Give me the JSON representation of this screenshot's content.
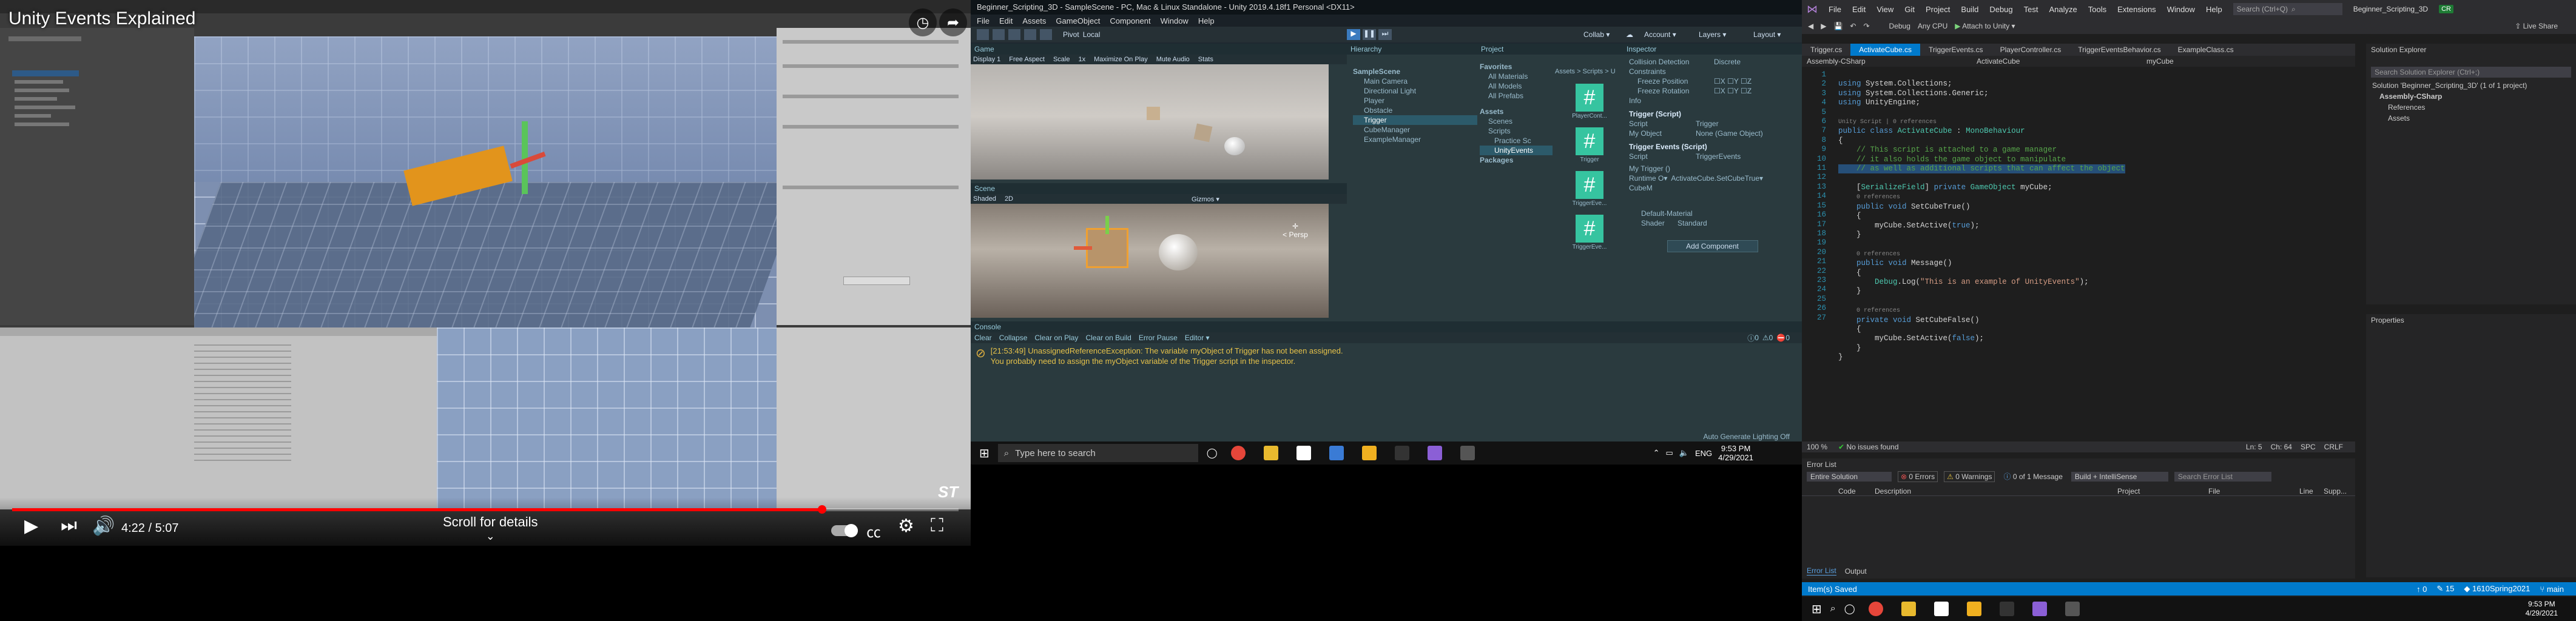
{
  "youtube": {
    "title": "Unity Events Explained",
    "time": "4:22 / 5:07",
    "progress": 0.855,
    "scroll_hint": "Scroll for details",
    "brand": "ST"
  },
  "unity": {
    "window_title": "Beginner_Scripting_3D - SampleScene - PC, Mac & Linux Standalone - Unity 2019.4.18f1 Personal <DX11>",
    "menu": [
      "File",
      "Edit",
      "Assets",
      "GameObject",
      "Component",
      "Window",
      "Help"
    ],
    "toolbar": {
      "pivot": "Pivot",
      "local": "Local",
      "collab": "Collab ▾",
      "account": "Account ▾",
      "layers": "Layers ▾",
      "layout": "Layout ▾"
    },
    "game": {
      "tab": "Game",
      "display": "Display 1",
      "aspect": "Free Aspect",
      "scale_label": "Scale",
      "scale": "1x",
      "maximize": "Maximize On Play",
      "mute": "Mute Audio",
      "stats": "Stats"
    },
    "scene": {
      "tab": "Scene",
      "shading": "Shaded",
      "mode": "2D",
      "gizmos": "Gizmos ▾",
      "persp": "< Persp"
    },
    "hierarchy": {
      "tab": "Hierarchy",
      "items": [
        "SampleScene",
        "Main Camera",
        "Directional Light",
        "Player",
        "Obstacle",
        "Trigger",
        "CubeManager",
        "ExampleManager"
      ]
    },
    "project": {
      "tab": "Project",
      "favorites": "Favorites",
      "fav_items": [
        "All Materials",
        "All Models",
        "All Prefabs"
      ],
      "assets": "Assets",
      "asset_items": [
        "Scenes",
        "Scripts",
        "Practice Sc",
        "UnityEvents"
      ],
      "packages": "Packages",
      "breadcrumb": "Assets > Scripts > U",
      "files": [
        "PlayerCont...",
        "Trigger",
        "TriggerEve...",
        "TriggerEve..."
      ]
    },
    "inspector": {
      "tab": "Inspector",
      "collision_label": "Collision Detection",
      "collision_value": "Discrete",
      "constraints": "Constraints",
      "freeze_pos": "Freeze Position",
      "freeze_rot": "Freeze Rotation",
      "info": "Info",
      "trigger_script": "Trigger (Script)",
      "script_label": "Script",
      "script_value": "Trigger",
      "my_object_label": "My Object",
      "my_object_value": "None (Game Object)",
      "events_script": "Trigger Events (Script)",
      "events_script_value": "TriggerEvents",
      "my_trigger": "My Trigger ()",
      "runtime": "Runtime O▾",
      "method": "ActivateCube.SetCubeTrue▾",
      "cube": "CubeM",
      "material": "Default-Material",
      "shader_label": "Shader",
      "shader_value": "Standard",
      "add_component": "Add Component"
    },
    "console": {
      "tab": "Console",
      "buttons": [
        "Clear",
        "Collapse",
        "Clear on Play",
        "Clear on Build",
        "Error Pause",
        "Editor ▾"
      ],
      "message_time": "[21:53:49]",
      "message1": "UnassignedReferenceException: The variable myObject of Trigger has not been assigned.",
      "message2": "You probably need to assign the myObject variable of the Trigger script in the inspector.",
      "status": "Auto Generate Lighting Off"
    },
    "counts": {
      "errors": "0",
      "warnings": "0",
      "messages": "0"
    },
    "taskbar": {
      "search": "Type here to search",
      "time": "9:53 PM",
      "date": "4/29/2021",
      "lang": "ENG"
    }
  },
  "vs": {
    "title": "Beginner_Scripting_3D",
    "menu": [
      "File",
      "Edit",
      "View",
      "Git",
      "Project",
      "Build",
      "Debug",
      "Test",
      "Analyze",
      "Tools",
      "Extensions",
      "Window",
      "Help"
    ],
    "search": "Search (Ctrl+Q)",
    "debug": "Debug",
    "cpu": "Any CPU",
    "attach": "Attach to Unity ▾",
    "live_share": "Live Share",
    "tabs": [
      "Trigger.cs",
      "ActivateCube.cs",
      "TriggerEvents.cs",
      "PlayerController.cs",
      "TriggerEventsBehavior.cs",
      "ExampleClass.cs"
    ],
    "nav": {
      "project": "Assembly-CSharp",
      "class": "ActivateCube",
      "member": "myCube"
    },
    "code_lines": [
      "1",
      "2",
      "3",
      "4",
      "5",
      "6",
      "7",
      "8",
      "9",
      "10",
      "11",
      "12",
      "13",
      "14",
      "15",
      "16",
      "17",
      "18",
      "19",
      "20",
      "21",
      "22",
      "23",
      "24",
      "25",
      "26",
      "27"
    ],
    "solution_explorer": {
      "title": "Solution Explorer",
      "search": "Search Solution Explorer (Ctrl+;)",
      "solution": "Solution 'Beginner_Scripting_3D' (1 of 1 project)",
      "project": "Assembly-CSharp",
      "items": [
        "References",
        "Assets"
      ]
    },
    "properties": "Properties",
    "editor_status": {
      "zoom": "100 %",
      "issues": "No issues found",
      "ln": "Ln: 5",
      "ch": "Ch: 64",
      "spc": "SPC",
      "crlf": "CRLF"
    },
    "error_list": {
      "title": "Error List",
      "scope": "Entire Solution",
      "errors": "0 Errors",
      "warnings": "0 Warnings",
      "messages": "0 of 1 Message",
      "build": "Build + IntelliSense",
      "search": "Search Error List",
      "cols": [
        "Code",
        "Description",
        "Project",
        "File",
        "Line",
        "Supp..."
      ],
      "tabs": [
        "Error List",
        "Output"
      ]
    },
    "status": {
      "saved": "Item(s) Saved",
      "up": "0",
      "pencil": "15",
      "repo": "1610Spring2021",
      "branch": "main"
    },
    "taskbar": {
      "time": "9:53 PM",
      "date": "4/29/2021"
    }
  }
}
